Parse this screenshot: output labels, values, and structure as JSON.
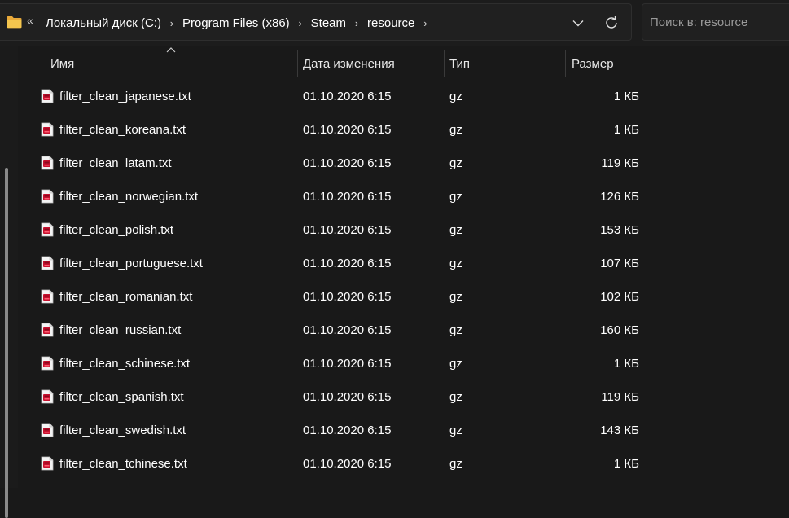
{
  "address_bar": {
    "overflow_glyph": "«",
    "crumbs": [
      "Локальный диск (C:)",
      "Program Files (x86)",
      "Steam",
      "resource"
    ],
    "separator_glyph": "›"
  },
  "search": {
    "placeholder": "Поиск в: resource",
    "value": ""
  },
  "columns": {
    "name": "Имя",
    "date": "Дата изменения",
    "type": "Тип",
    "size": "Размер",
    "sorted_by": "name",
    "sort_direction": "ascending"
  },
  "files": [
    {
      "name": "filter_clean_japanese.txt",
      "date": "01.10.2020 6:15",
      "type": "gz",
      "size": "1 КБ"
    },
    {
      "name": "filter_clean_koreana.txt",
      "date": "01.10.2020 6:15",
      "type": "gz",
      "size": "1 КБ"
    },
    {
      "name": "filter_clean_latam.txt",
      "date": "01.10.2020 6:15",
      "type": "gz",
      "size": "119 КБ"
    },
    {
      "name": "filter_clean_norwegian.txt",
      "date": "01.10.2020 6:15",
      "type": "gz",
      "size": "126 КБ"
    },
    {
      "name": "filter_clean_polish.txt",
      "date": "01.10.2020 6:15",
      "type": "gz",
      "size": "153 КБ"
    },
    {
      "name": "filter_clean_portuguese.txt",
      "date": "01.10.2020 6:15",
      "type": "gz",
      "size": "107 КБ"
    },
    {
      "name": "filter_clean_romanian.txt",
      "date": "01.10.2020 6:15",
      "type": "gz",
      "size": "102 КБ"
    },
    {
      "name": "filter_clean_russian.txt",
      "date": "01.10.2020 6:15",
      "type": "gz",
      "size": "160 КБ"
    },
    {
      "name": "filter_clean_schinese.txt",
      "date": "01.10.2020 6:15",
      "type": "gz",
      "size": "1 КБ"
    },
    {
      "name": "filter_clean_spanish.txt",
      "date": "01.10.2020 6:15",
      "type": "gz",
      "size": "119 КБ"
    },
    {
      "name": "filter_clean_swedish.txt",
      "date": "01.10.2020 6:15",
      "type": "gz",
      "size": "143 КБ"
    },
    {
      "name": "filter_clean_tchinese.txt",
      "date": "01.10.2020 6:15",
      "type": "gz",
      "size": "1 КБ"
    }
  ],
  "icons": {
    "folder": "folder-icon",
    "file": "archive-file-icon",
    "dropdown": "chevron-down-icon",
    "refresh": "refresh-icon",
    "sort": "sort-ascending-icon"
  },
  "colors": {
    "background": "#191919",
    "bar": "#202020",
    "folder": "#f3c24a",
    "file_icon": "#c8102e",
    "text": "#ffffff"
  }
}
